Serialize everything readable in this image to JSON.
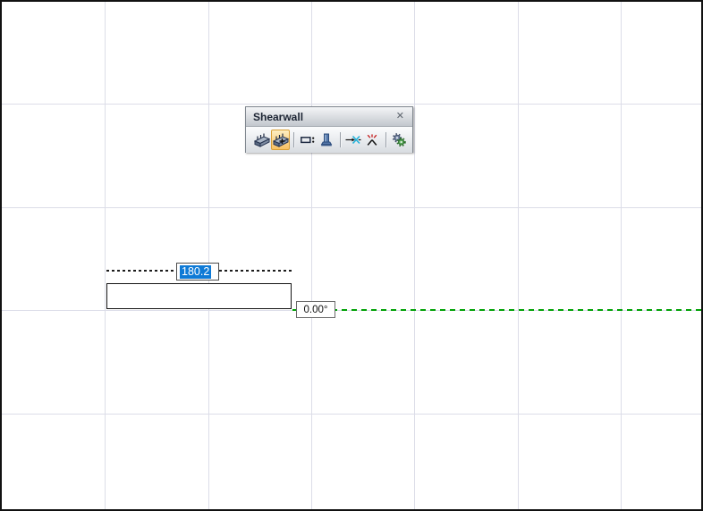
{
  "window": {
    "background": "#ffffff",
    "border_color": "#111111",
    "grid_color": "#dcdde8"
  },
  "toolbar": {
    "title": "Shearwall",
    "close_glyph": "✕",
    "selected_button_color": "#f8c163",
    "buttons": [
      {
        "id": "shearwall",
        "icon": "shearwall-icon",
        "selected": false
      },
      {
        "id": "add-shearwall",
        "icon": "add-shearwall-icon",
        "selected": true
      },
      {
        "id": "wall-opening",
        "icon": "wall-opening-icon",
        "selected": false
      },
      {
        "id": "column",
        "icon": "column-icon",
        "selected": false
      },
      {
        "id": "snap-intersection",
        "icon": "snap-intersection-icon",
        "selected": false
      },
      {
        "id": "remove-intersection",
        "icon": "remove-intersection-icon",
        "selected": false
      },
      {
        "id": "settings",
        "icon": "gears-icon",
        "selected": false
      }
    ]
  },
  "drawing": {
    "dimension_input": {
      "value": "180.2",
      "selected": true,
      "selection_color": "#0e7ad6",
      "text_color": "#ffffff"
    },
    "angle_input": {
      "value": "0.00°"
    },
    "wall_outline_color": "#151515",
    "dimension_line_color": "#1c1c1c",
    "guide_line_color": "#00a206"
  }
}
